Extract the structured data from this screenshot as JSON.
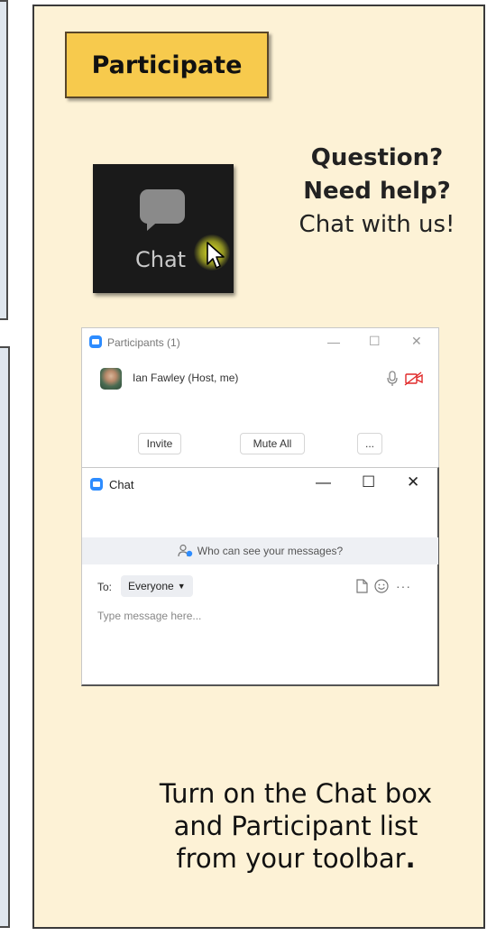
{
  "tab": {
    "label": "Participate"
  },
  "chat_thumbnail": {
    "label": "Chat",
    "icon": "chat-bubble-icon",
    "cursor": "cursor-arrow-icon"
  },
  "help": {
    "line1": "Question?",
    "line2": "Need help?",
    "line3": "Chat with us!"
  },
  "participants_window": {
    "title": "Participants (1)",
    "controls": {
      "minimize": "—",
      "maximize": "☐",
      "close": "✕"
    },
    "participant": {
      "name": "Ian Fawley (Host, me)"
    },
    "buttons": {
      "invite": "Invite",
      "mute_all": "Mute All",
      "more": "..."
    }
  },
  "chat_window": {
    "title": "Chat",
    "controls": {
      "minimize": "—",
      "maximize": "☐",
      "close": "✕"
    },
    "who_can_see": "Who can see your messages?",
    "to_label": "To:",
    "recipient": "Everyone",
    "message_placeholder": "Type message here..."
  },
  "instruction": {
    "line1": "Turn on the Chat box",
    "line2": "and Participant list",
    "line3": "from your toolbar",
    "period": "."
  },
  "colors": {
    "card_bg": "#fdf2d6",
    "tab_bg": "#f7ca4d",
    "zoom_blue": "#2d8cff",
    "video_off_red": "#e02828"
  }
}
